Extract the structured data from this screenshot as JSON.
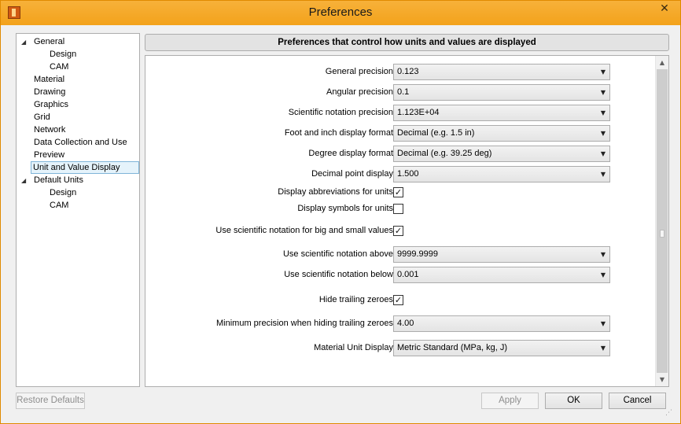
{
  "window": {
    "title": "Preferences",
    "close_glyph": "✕"
  },
  "tree": {
    "items": [
      {
        "label": "General",
        "expanded": true
      },
      {
        "label": "Design"
      },
      {
        "label": "CAM"
      },
      {
        "label": "Material"
      },
      {
        "label": "Drawing"
      },
      {
        "label": "Graphics"
      },
      {
        "label": "Grid"
      },
      {
        "label": "Network"
      },
      {
        "label": "Data Collection and Use"
      },
      {
        "label": "Preview"
      },
      {
        "label": "Unit and Value Display",
        "selected": true
      },
      {
        "label": "Default Units",
        "expanded": true
      },
      {
        "label": "Design"
      },
      {
        "label": "CAM"
      }
    ],
    "expander_glyph": "◢"
  },
  "header": {
    "text": "Preferences that control how units and values are displayed"
  },
  "settings": {
    "general_precision": {
      "label": "General precision",
      "value": "0.123"
    },
    "angular_precision": {
      "label": "Angular precision",
      "value": "0.1"
    },
    "scientific_precision": {
      "label": "Scientific notation precision",
      "value": "1.123E+04"
    },
    "foot_inch_format": {
      "label": "Foot and inch display format",
      "value": "Decimal (e.g. 1.5 in)"
    },
    "degree_format": {
      "label": "Degree display format",
      "value": "Decimal (e.g. 39.25 deg)"
    },
    "decimal_point": {
      "label": "Decimal point display",
      "value": "1.500"
    },
    "display_abbreviations": {
      "label": "Display abbreviations for units",
      "checked": true
    },
    "display_symbols": {
      "label": "Display symbols for units",
      "checked": false
    },
    "use_scientific": {
      "label": "Use scientific notation for big and small values",
      "checked": true
    },
    "scientific_above": {
      "label": "Use scientific notation above",
      "value": "9999.9999"
    },
    "scientific_below": {
      "label": "Use scientific notation below",
      "value": "0.001"
    },
    "hide_trailing_zeroes": {
      "label": "Hide trailing zeroes",
      "checked": true
    },
    "min_precision_hiding": {
      "label": "Minimum precision when hiding trailing zeroes",
      "value": "4.00"
    },
    "material_unit_display": {
      "label": "Material Unit Display",
      "value": "Metric Standard (MPa, kg, J)"
    }
  },
  "glyphs": {
    "dropdown_arrow": "▼",
    "check": "✓",
    "scroll_up": "▲",
    "scroll_down": "▼"
  },
  "buttons": {
    "restore_defaults": "Restore Defaults",
    "apply": "Apply",
    "ok": "OK",
    "cancel": "Cancel"
  },
  "colors": {
    "titlebar": "#f5a623",
    "selection": "#e5f3fb"
  }
}
